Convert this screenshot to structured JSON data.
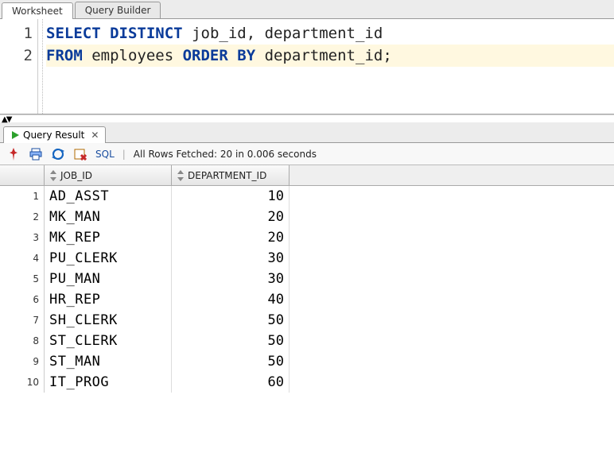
{
  "tabs": {
    "worksheet": "Worksheet",
    "querybuilder": "Query Builder"
  },
  "editor": {
    "lines": [
      {
        "n": "1",
        "tokens": [
          {
            "t": "kw",
            "v": "SELECT"
          },
          {
            "t": "sp",
            "v": " "
          },
          {
            "t": "kw",
            "v": "DISTINCT"
          },
          {
            "t": "sp",
            "v": " "
          },
          {
            "t": "txt",
            "v": "job_id, department_id"
          }
        ],
        "hl": false
      },
      {
        "n": "2",
        "tokens": [
          {
            "t": "kw",
            "v": "FROM"
          },
          {
            "t": "sp",
            "v": " "
          },
          {
            "t": "txt",
            "v": "employees "
          },
          {
            "t": "kw",
            "v": "ORDER"
          },
          {
            "t": "sp",
            "v": " "
          },
          {
            "t": "kw",
            "v": "BY"
          },
          {
            "t": "sp",
            "v": " "
          },
          {
            "t": "txt",
            "v": "department_id;"
          }
        ],
        "hl": true
      }
    ]
  },
  "result_tab": {
    "label": "Query Result"
  },
  "toolbar": {
    "sql_label": "SQL",
    "status": "All Rows Fetched: 20 in 0.006 seconds"
  },
  "grid": {
    "columns": {
      "job_id": "JOB_ID",
      "department_id": "DEPARTMENT_ID"
    },
    "rows": [
      {
        "n": "1",
        "job_id": "AD_ASST",
        "department_id": "10"
      },
      {
        "n": "2",
        "job_id": "MK_MAN",
        "department_id": "20"
      },
      {
        "n": "3",
        "job_id": "MK_REP",
        "department_id": "20"
      },
      {
        "n": "4",
        "job_id": "PU_CLERK",
        "department_id": "30"
      },
      {
        "n": "5",
        "job_id": "PU_MAN",
        "department_id": "30"
      },
      {
        "n": "6",
        "job_id": "HR_REP",
        "department_id": "40"
      },
      {
        "n": "7",
        "job_id": "SH_CLERK",
        "department_id": "50"
      },
      {
        "n": "8",
        "job_id": "ST_CLERK",
        "department_id": "50"
      },
      {
        "n": "9",
        "job_id": "ST_MAN",
        "department_id": "50"
      },
      {
        "n": "10",
        "job_id": "IT_PROG",
        "department_id": "60"
      }
    ]
  }
}
